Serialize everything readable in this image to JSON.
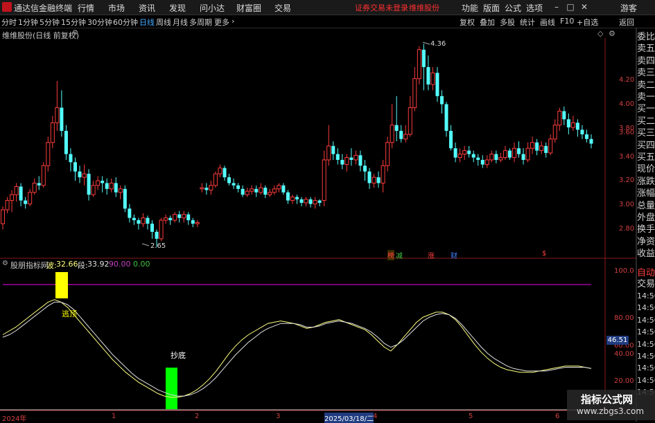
{
  "menubar": {
    "app_name": "通达信金融终端",
    "items": [
      "行情",
      "市场",
      "资讯",
      "发现",
      "问小达",
      "财富圈",
      "交易"
    ],
    "status": [
      "证券交易未登录",
      "维维股份"
    ],
    "right_items": [
      "功能",
      "版面",
      "公式",
      "选项"
    ],
    "user": "游客"
  },
  "toolbar": {
    "periods": [
      "分时",
      "1分钟",
      "5分钟",
      "15分钟",
      "30分钟",
      "60分钟",
      "日线",
      "周线",
      "月线",
      "多周期",
      "更多"
    ],
    "active_period": "日线",
    "tools": [
      "复权",
      "叠加",
      "多股",
      "统计",
      "画线",
      "F10",
      "+自选",
      "返回"
    ]
  },
  "main_chart": {
    "title": "维维股份(日线 前复权)",
    "high_label": "4.36",
    "low_label": "2.65",
    "yticks": [
      "4.20",
      "4.00",
      "3.80",
      "3.60",
      "3.40",
      "3.20",
      "3.00",
      "2.80"
    ],
    "event_tags": [
      {
        "text": "榜",
        "color": "#ff4040"
      },
      {
        "text": "减",
        "color": "#40c040"
      },
      {
        "text": "涨",
        "color": "#ff4040"
      },
      {
        "text": "财",
        "color": "#4080ff"
      },
      {
        "text": "$",
        "color": "#ff4040"
      }
    ]
  },
  "indicator": {
    "name": "股朋指标网",
    "label_wave": "波:",
    "wave_value": "32.66",
    "label_segment": "段:",
    "segment_value": "33.92",
    "level_high": "90.00",
    "level_low": "0.00",
    "top_signal": "逃顶",
    "bottom_signal": "抄底",
    "yticks": [
      "100.0",
      "80.00",
      "60.00",
      "40.00",
      "20.00"
    ],
    "current_tag": "46.51"
  },
  "x_axis": {
    "labels": [
      "2024年",
      "1",
      "2",
      "3",
      "2025/03/18/二",
      "4",
      "5",
      "6"
    ]
  },
  "right_panel": {
    "items": [
      "委比",
      "卖五",
      "卖四",
      "卖三",
      "卖二",
      "卖一",
      "买一",
      "买二",
      "买三",
      "买四",
      "买五",
      "现价",
      "涨跌",
      "涨幅",
      "总量",
      "外盘",
      "换手",
      "净资",
      "收益"
    ],
    "lower": [
      "自动",
      "交易"
    ],
    "times": [
      "14:56",
      "14:56",
      "14:56",
      "14:56",
      "14:56",
      "14:56",
      "14:56",
      "14:56",
      "14:56"
    ]
  },
  "watermark": {
    "line1": "指标公式网",
    "line2": "www.zbgs3.com"
  },
  "chart_data": {
    "type": "candlestick",
    "ylim": [
      2.6,
      4.45
    ],
    "candles": [
      [
        2.85,
        2.97,
        2.8,
        3.0
      ],
      [
        2.97,
        3.05,
        2.94,
        3.08
      ],
      [
        3.05,
        3.1,
        2.95,
        3.14
      ],
      [
        3.1,
        3.17,
        3.04,
        3.2
      ],
      [
        3.17,
        3.05,
        3.0,
        3.2
      ],
      [
        3.05,
        3.02,
        2.98,
        3.08
      ],
      [
        3.02,
        3.12,
        3.0,
        3.15
      ],
      [
        3.12,
        3.2,
        3.1,
        3.24
      ],
      [
        3.2,
        3.18,
        3.14,
        3.26
      ],
      [
        3.18,
        3.35,
        3.16,
        3.38
      ],
      [
        3.35,
        3.55,
        3.3,
        3.6
      ],
      [
        3.55,
        3.72,
        3.5,
        3.78
      ],
      [
        3.72,
        3.85,
        3.65,
        4.08
      ],
      [
        3.85,
        3.65,
        3.6,
        4.0
      ],
      [
        3.65,
        3.45,
        3.4,
        3.7
      ],
      [
        3.45,
        3.38,
        3.3,
        3.5
      ],
      [
        3.38,
        3.3,
        3.22,
        3.42
      ],
      [
        3.3,
        3.25,
        3.2,
        3.35
      ],
      [
        3.25,
        3.28,
        3.18,
        3.36
      ],
      [
        3.28,
        3.1,
        3.05,
        3.32
      ],
      [
        3.1,
        3.18,
        3.08,
        3.22
      ],
      [
        3.18,
        3.22,
        3.14,
        3.26
      ],
      [
        3.22,
        3.2,
        3.12,
        3.26
      ],
      [
        3.2,
        3.15,
        3.1,
        3.24
      ],
      [
        3.15,
        3.2,
        3.12,
        3.24
      ],
      [
        3.2,
        3.12,
        3.08,
        3.25
      ],
      [
        3.12,
        3.15,
        3.06,
        3.18
      ],
      [
        3.15,
        2.98,
        2.95,
        3.18
      ],
      [
        2.98,
        2.9,
        2.86,
        3.02
      ],
      [
        2.9,
        2.88,
        2.84,
        2.93
      ],
      [
        2.88,
        2.85,
        2.8,
        2.9
      ],
      [
        2.85,
        2.9,
        2.82,
        2.94
      ],
      [
        2.9,
        2.85,
        2.8,
        2.92
      ],
      [
        2.85,
        2.78,
        2.72,
        2.88
      ],
      [
        2.78,
        2.72,
        2.65,
        2.8
      ],
      [
        2.72,
        2.88,
        2.7,
        2.9
      ],
      [
        2.88,
        2.9,
        2.85,
        2.93
      ],
      [
        2.9,
        2.88,
        2.84,
        2.92
      ],
      [
        2.88,
        2.93,
        2.86,
        2.95
      ],
      [
        2.93,
        2.9,
        2.86,
        2.96
      ],
      [
        2.9,
        2.93,
        2.86,
        2.96
      ],
      [
        2.93,
        2.88,
        2.84,
        2.95
      ],
      [
        2.88,
        2.85,
        2.82,
        2.9
      ],
      [
        2.85,
        2.86,
        2.82,
        2.88
      ],
      [
        3.15,
        3.16,
        3.12,
        3.2
      ],
      [
        3.16,
        3.14,
        3.1,
        3.2
      ],
      [
        3.14,
        3.18,
        3.1,
        3.22
      ],
      [
        3.18,
        3.28,
        3.16,
        3.3
      ],
      [
        3.28,
        3.33,
        3.25,
        3.36
      ],
      [
        3.33,
        3.25,
        3.22,
        3.35
      ],
      [
        3.25,
        3.2,
        3.18,
        3.28
      ],
      [
        3.2,
        3.18,
        3.15,
        3.24
      ],
      [
        3.18,
        3.15,
        3.12,
        3.2
      ],
      [
        3.15,
        3.1,
        3.08,
        3.18
      ],
      [
        3.1,
        3.13,
        3.08,
        3.16
      ],
      [
        3.13,
        3.15,
        3.1,
        3.18
      ],
      [
        3.15,
        3.12,
        3.08,
        3.18
      ],
      [
        3.12,
        3.16,
        3.1,
        3.2
      ],
      [
        3.16,
        3.1,
        3.07,
        3.18
      ],
      [
        3.1,
        3.12,
        3.08,
        3.15
      ],
      [
        3.12,
        3.15,
        3.1,
        3.18
      ],
      [
        3.15,
        3.18,
        3.12,
        3.2
      ],
      [
        3.18,
        3.12,
        3.1,
        3.2
      ],
      [
        3.12,
        3.05,
        3.02,
        3.14
      ],
      [
        3.05,
        3.08,
        3.02,
        3.1
      ],
      [
        3.08,
        3.06,
        3.02,
        3.1
      ],
      [
        3.06,
        3.03,
        3.0,
        3.08
      ],
      [
        3.03,
        3.06,
        3.0,
        3.08
      ],
      [
        3.06,
        3.02,
        2.99,
        3.08
      ],
      [
        3.02,
        3.05,
        2.98,
        3.08
      ],
      [
        3.05,
        3.03,
        3.0,
        3.06
      ],
      [
        3.05,
        3.4,
        3.0,
        3.48
      ],
      [
        3.4,
        3.52,
        3.35,
        3.7
      ],
      [
        3.52,
        3.45,
        3.4,
        3.56
      ],
      [
        3.45,
        3.4,
        3.36,
        3.5
      ],
      [
        3.4,
        3.36,
        3.32,
        3.45
      ],
      [
        3.36,
        3.42,
        3.3,
        3.45
      ],
      [
        3.42,
        3.4,
        3.35,
        3.5
      ],
      [
        3.4,
        3.44,
        3.36,
        3.48
      ],
      [
        3.44,
        3.35,
        3.3,
        3.48
      ],
      [
        3.35,
        3.3,
        3.22,
        3.4
      ],
      [
        3.3,
        3.2,
        3.15,
        3.33
      ],
      [
        3.2,
        3.25,
        3.16,
        3.28
      ],
      [
        3.25,
        3.2,
        3.16,
        3.3
      ],
      [
        3.2,
        3.35,
        3.12,
        3.4
      ],
      [
        3.35,
        3.55,
        3.3,
        3.6
      ],
      [
        3.55,
        3.7,
        3.5,
        3.88
      ],
      [
        3.7,
        3.65,
        3.56,
        3.95
      ],
      [
        3.65,
        3.58,
        3.55,
        3.7
      ],
      [
        3.58,
        3.62,
        3.55,
        3.7
      ],
      [
        3.62,
        3.85,
        3.6,
        3.95
      ],
      [
        3.85,
        4.1,
        3.82,
        4.2
      ],
      [
        4.1,
        4.35,
        4.05,
        4.38
      ],
      [
        4.35,
        4.2,
        4.0,
        4.4
      ],
      [
        4.2,
        4.05,
        4.0,
        4.3
      ],
      [
        4.05,
        4.15,
        4.0,
        4.2
      ],
      [
        4.15,
        3.95,
        3.9,
        4.2
      ],
      [
        3.95,
        3.88,
        3.8,
        4.0
      ],
      [
        3.88,
        3.65,
        3.6,
        3.9
      ],
      [
        3.65,
        3.5,
        3.48,
        3.7
      ],
      [
        3.5,
        3.42,
        3.38,
        3.55
      ],
      [
        3.42,
        3.45,
        3.38,
        3.5
      ],
      [
        3.45,
        3.48,
        3.4,
        3.52
      ],
      [
        3.48,
        3.45,
        3.42,
        3.52
      ],
      [
        3.45,
        3.42,
        3.38,
        3.48
      ],
      [
        3.42,
        3.4,
        3.35,
        3.45
      ],
      [
        3.4,
        3.36,
        3.33,
        3.44
      ],
      [
        3.36,
        3.4,
        3.33,
        3.44
      ],
      [
        3.4,
        3.45,
        3.38,
        3.48
      ],
      [
        3.45,
        3.4,
        3.37,
        3.48
      ],
      [
        3.4,
        3.42,
        3.38,
        3.46
      ],
      [
        3.42,
        3.48,
        3.4,
        3.52
      ],
      [
        3.48,
        3.42,
        3.4,
        3.5
      ],
      [
        3.42,
        3.5,
        3.38,
        3.55
      ],
      [
        3.5,
        3.45,
        3.42,
        3.56
      ],
      [
        3.45,
        3.4,
        3.36,
        3.5
      ],
      [
        3.4,
        3.5,
        3.38,
        3.55
      ],
      [
        3.5,
        3.55,
        3.45,
        3.6
      ],
      [
        3.55,
        3.48,
        3.44,
        3.58
      ],
      [
        3.48,
        3.52,
        3.45,
        3.56
      ],
      [
        3.52,
        3.46,
        3.42,
        3.55
      ],
      [
        3.46,
        3.58,
        3.44,
        3.62
      ],
      [
        3.58,
        3.7,
        3.55,
        3.75
      ],
      [
        3.7,
        3.82,
        3.65,
        3.85
      ],
      [
        3.82,
        3.75,
        3.7,
        3.86
      ],
      [
        3.75,
        3.68,
        3.62,
        3.8
      ],
      [
        3.68,
        3.72,
        3.65,
        3.78
      ],
      [
        3.72,
        3.66,
        3.6,
        3.75
      ],
      [
        3.66,
        3.62,
        3.58,
        3.7
      ],
      [
        3.62,
        3.58,
        3.55,
        3.66
      ],
      [
        3.58,
        3.54,
        3.5,
        3.62
      ]
    ],
    "indicator_ylim": [
      0,
      110
    ],
    "wave": [
      60,
      63,
      66,
      70,
      74,
      78,
      82,
      86,
      88,
      86,
      82,
      76,
      70,
      64,
      58,
      52,
      46,
      40,
      35,
      30,
      26,
      22,
      19,
      16,
      13,
      11,
      10,
      10,
      11,
      13,
      16,
      20,
      25,
      31,
      38,
      45,
      51,
      56,
      60,
      63,
      66,
      69,
      70,
      71,
      70,
      69,
      67,
      65,
      66,
      68,
      70,
      71,
      72,
      70,
      68,
      66,
      64,
      60,
      55,
      50,
      47,
      52,
      58,
      64,
      70,
      74,
      76,
      78,
      78,
      76,
      72,
      66,
      59,
      52,
      46,
      41,
      37,
      34,
      32,
      31,
      30,
      30,
      30,
      31,
      32,
      33,
      34,
      35,
      35,
      35,
      34,
      33
    ],
    "segment": [
      58,
      60,
      63,
      67,
      71,
      75,
      79,
      83,
      86,
      86,
      84,
      80,
      74,
      68,
      62,
      56,
      50,
      44,
      39,
      34,
      29,
      25,
      22,
      19,
      16,
      14,
      12,
      11,
      11,
      12,
      14,
      17,
      21,
      26,
      32,
      38,
      44,
      49,
      54,
      58,
      62,
      65,
      67,
      69,
      69,
      69,
      68,
      66,
      66,
      67,
      69,
      70,
      71,
      70,
      69,
      67,
      65,
      62,
      58,
      53,
      50,
      52,
      56,
      61,
      66,
      71,
      74,
      76,
      77,
      76,
      73,
      68,
      62,
      56,
      50,
      45,
      41,
      38,
      35,
      33,
      32,
      31,
      31,
      31,
      31,
      32,
      33,
      34,
      34,
      34,
      34,
      33
    ]
  }
}
